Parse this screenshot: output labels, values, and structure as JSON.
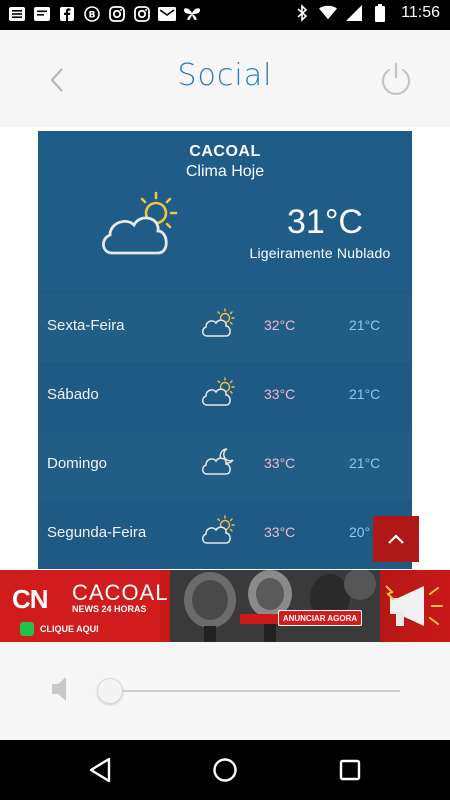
{
  "status_bar": {
    "time": "11:56",
    "left_icons": [
      "menu-icon",
      "message-icon",
      "facebook-icon",
      "b-icon",
      "instagram-icon",
      "instagram-icon",
      "mail-icon",
      "butterfly-icon"
    ],
    "right_icons": [
      "bluetooth-icon",
      "wifi-icon",
      "signal-icon",
      "battery-icon"
    ]
  },
  "header": {
    "title": "Social"
  },
  "weather": {
    "city": "CACOAL",
    "subtitle": "Clima Hoje",
    "temperature": "31°C",
    "condition": "Ligeiramente Nublado",
    "icon": "partly-cloudy-icon",
    "forecast": [
      {
        "day": "Sexta-Feira",
        "icon": "partly-cloudy-icon",
        "max": "32°C",
        "min": "21°C"
      },
      {
        "day": "Sábado",
        "icon": "partly-cloudy-icon",
        "max": "33°C",
        "min": "21°C"
      },
      {
        "day": "Domingo",
        "icon": "cloudy-night-icon",
        "max": "33°C",
        "min": "21°C"
      },
      {
        "day": "Segunda-Feira",
        "icon": "partly-cloudy-icon",
        "max": "33°C",
        "min": "20°"
      }
    ]
  },
  "ad": {
    "logo": "CN",
    "name": "CACOAL",
    "tagline": "NEWS 24 HORAS",
    "click_label": "CLIQUE AQUI",
    "cta": "ANUNCIAR AGORA"
  },
  "player": {
    "volume_fraction": 0.0
  },
  "colors": {
    "accent": "#2a7ab8",
    "weather_bg": "#1e5a84",
    "max_temp": "#f0b8d0",
    "min_temp": "#8fc8f0",
    "ad_red": "#cc1a1a"
  }
}
